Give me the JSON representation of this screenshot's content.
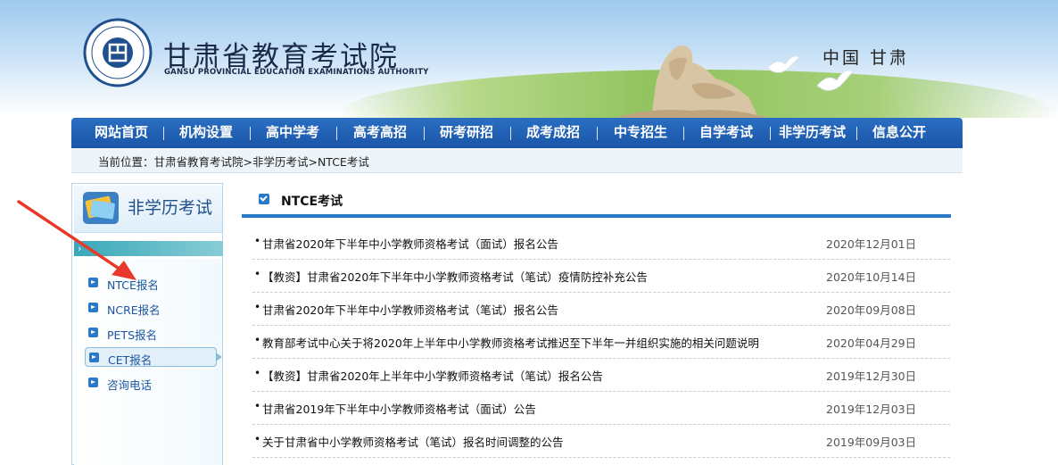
{
  "header": {
    "site_title": "甘肃省教育考试院",
    "site_subtitle": "GANSU PROVINCIAL EDUCATION EXAMINATIONS AUTHORITY",
    "region": "中国 甘肃",
    "logo_icon": "provincial-emblem-icon"
  },
  "nav": {
    "items": [
      {
        "label": "网站首页"
      },
      {
        "label": "机构设置"
      },
      {
        "label": "高中学考"
      },
      {
        "label": "高考高招"
      },
      {
        "label": "研考研招"
      },
      {
        "label": "成考成招"
      },
      {
        "label": "中专招生"
      },
      {
        "label": "自学考试"
      },
      {
        "label": "非学历考试"
      },
      {
        "label": "信息公开"
      }
    ]
  },
  "breadcrumb": "当前位置：甘肃省教育考试院>非学历考试>NTCE考试",
  "sidebar": {
    "title": "非学历考试",
    "items": [
      {
        "label": "NTCE报名",
        "active": false
      },
      {
        "label": "NCRE报名",
        "active": false
      },
      {
        "label": "PETS报名",
        "active": false
      },
      {
        "label": "CET报名",
        "active": true
      },
      {
        "label": "咨询电话",
        "active": false
      }
    ]
  },
  "content": {
    "title": "NTCE考试",
    "news": [
      {
        "title": "甘肃省2020年下半年中小学教师资格考试（面试）报名公告",
        "date": "2020年12月01日"
      },
      {
        "title": "【教资】甘肃省2020年下半年中小学教师资格考试（笔试）疫情防控补充公告",
        "date": "2020年10月14日"
      },
      {
        "title": "甘肃省2020年下半年中小学教师资格考试（笔试）报名公告",
        "date": "2020年09月08日"
      },
      {
        "title": "教育部考试中心关于将2020年上半年中小学教师资格考试推迟至下半年一并组织实施的相关问题说明",
        "date": "2020年04月29日"
      },
      {
        "title": "【教资】甘肃省2020年上半年中小学教师资格考试（笔试）报名公告",
        "date": "2019年12月30日"
      },
      {
        "title": "甘肃省2019年下半年中小学教师资格考试（面试）公告",
        "date": "2019年12月03日"
      },
      {
        "title": "关于甘肃省中小学教师资格考试（笔试）报名时间调整的公告",
        "date": "2019年09月03日"
      }
    ]
  },
  "colors": {
    "nav_bg": "#1a56a8",
    "accent": "#2a78c8",
    "annotation_arrow": "#e8392b"
  }
}
